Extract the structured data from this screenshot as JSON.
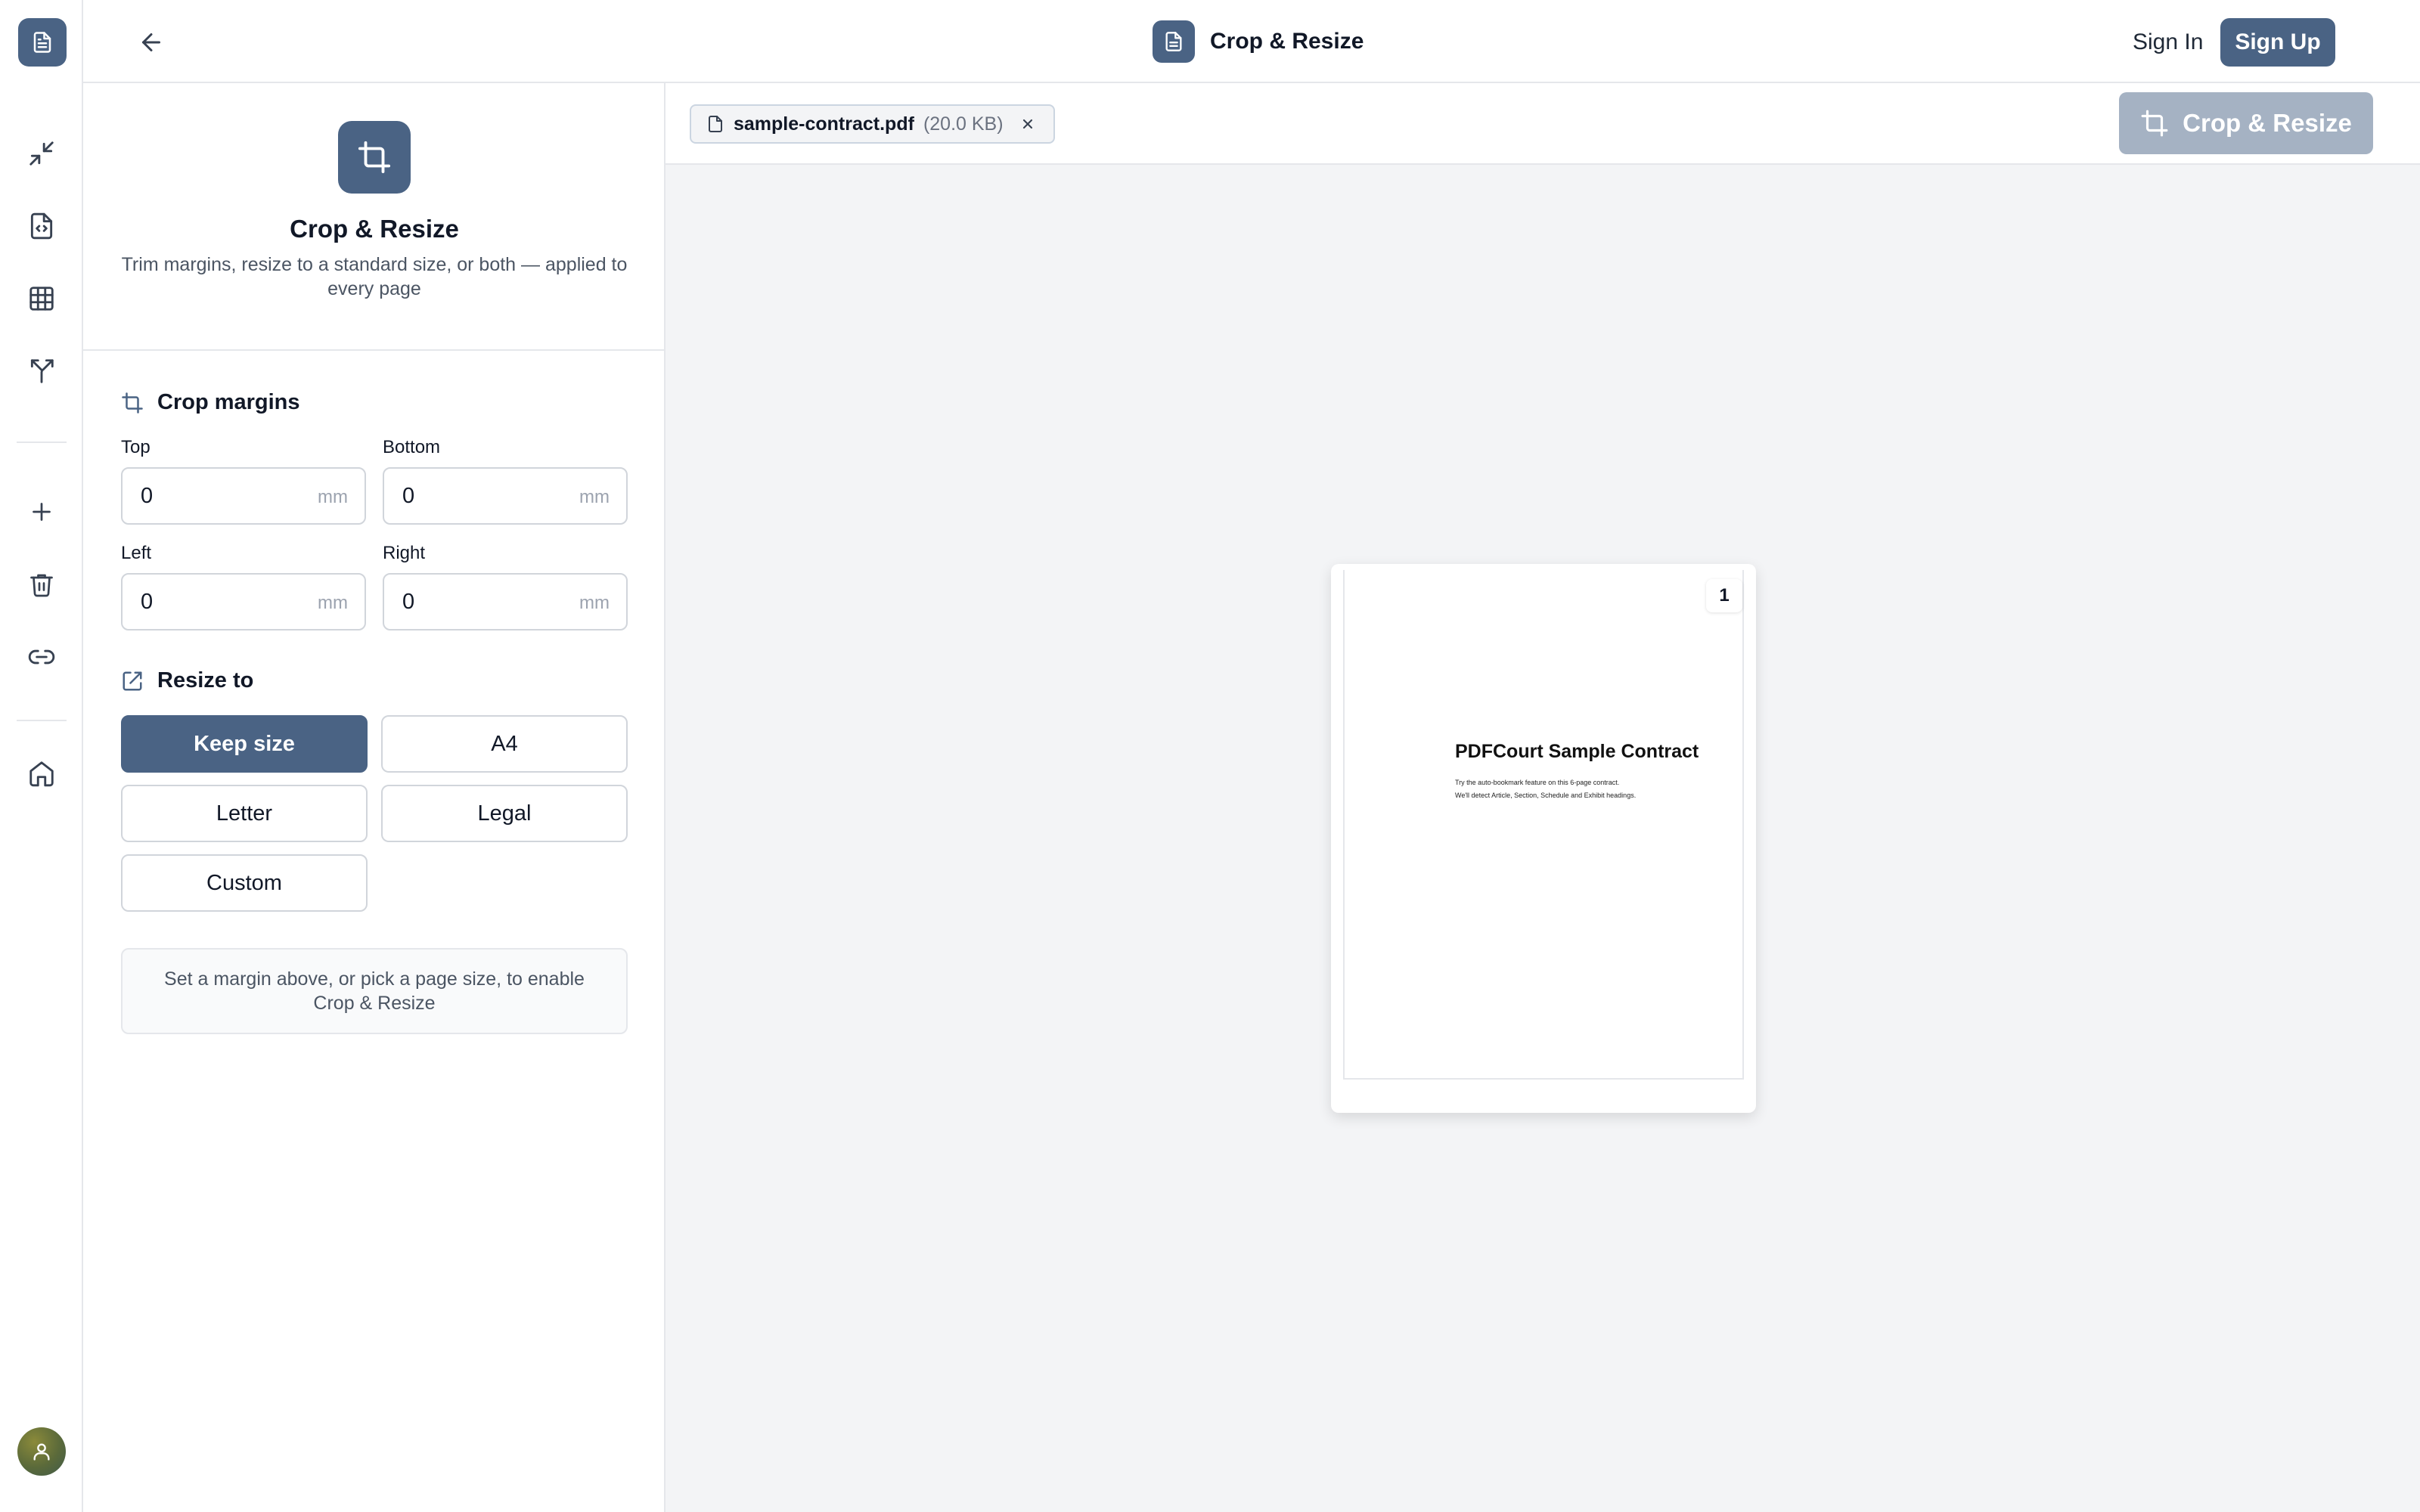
{
  "app": {
    "title": "Crop & Resize"
  },
  "header": {
    "title": "Crop & Resize",
    "sign_in": "Sign In",
    "sign_up": "Sign Up"
  },
  "rail": {
    "icons": [
      "document-icon",
      "compress-icon",
      "code-file-icon",
      "grid-icon",
      "merge-split-icon",
      "plus-icon",
      "trash-icon",
      "link-icon",
      "home-icon",
      "user-icon"
    ]
  },
  "panel": {
    "tool_title": "Crop & Resize",
    "tool_desc": "Trim margins, resize to a standard size, or both — applied to every page",
    "crop_section": "Crop margins",
    "fields": {
      "top": {
        "label": "Top",
        "value": "0",
        "unit": "mm"
      },
      "bottom": {
        "label": "Bottom",
        "value": "0",
        "unit": "mm"
      },
      "left": {
        "label": "Left",
        "value": "0",
        "unit": "mm"
      },
      "right": {
        "label": "Right",
        "value": "0",
        "unit": "mm"
      }
    },
    "resize_section": "Resize to",
    "sizes": [
      "Keep size",
      "A4",
      "Letter",
      "Legal",
      "Custom"
    ],
    "selected_size": "Keep size",
    "note": "Set a margin above, or pick a page size, to enable Crop & Resize"
  },
  "main": {
    "file": {
      "name": "sample-contract.pdf",
      "size": "(20.0 KB)"
    },
    "action_label": "Crop & Resize",
    "page": {
      "number": "1",
      "title": "PDFCourt Sample Contract",
      "line1": "Try the auto-bookmark feature on this 6-page contract.",
      "line2": "We'll detect Article, Section, Schedule and Exhibit headings."
    }
  },
  "colors": {
    "accent": "#4a6384",
    "disabled_accent": "#a5b2c3"
  }
}
